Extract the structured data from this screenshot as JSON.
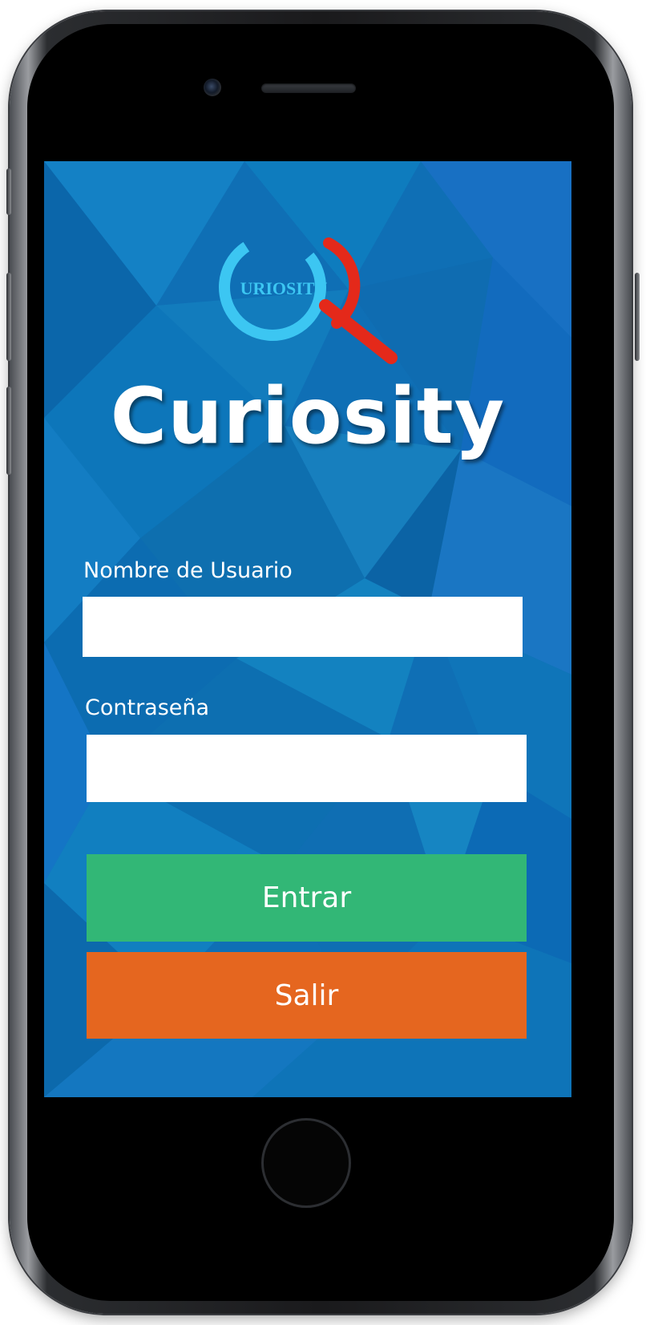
{
  "app": {
    "logo_text": "URIOSITY",
    "title": "Curiosity"
  },
  "form": {
    "username_label": "Nombre de Usuario",
    "username_value": "",
    "password_label": "Contraseña",
    "password_value": ""
  },
  "buttons": {
    "enter_label": "Entrar",
    "exit_label": "Salir"
  },
  "colors": {
    "background_primary": "#0f6fb5",
    "background_secondary": "#1a88c9",
    "logo_ring": "#3cc6f2",
    "logo_magnifier": "#e4291a",
    "enter_button": "#32b776",
    "exit_button": "#e5661f",
    "text_light": "#ffffff"
  },
  "icons": {
    "logo": "magnifier-logo-icon",
    "camera": "front-camera-icon",
    "speaker": "earpiece-speaker-icon",
    "home": "home-button-icon"
  }
}
